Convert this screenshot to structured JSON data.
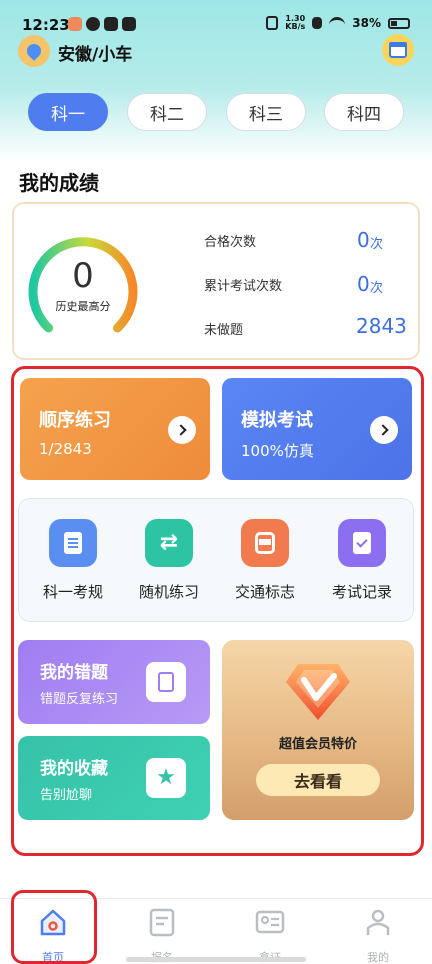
{
  "status_bar": {
    "time": "12:23",
    "net_speed_value": "1.30",
    "net_speed_unit": "KB/s",
    "battery": "38%"
  },
  "header": {
    "location": "安徽/小车",
    "location_icon": "map-pin-icon",
    "calendar_icon": "calendar-check-icon"
  },
  "tabs": [
    {
      "label": "科一",
      "active": true
    },
    {
      "label": "科二",
      "active": false
    },
    {
      "label": "科三",
      "active": false
    },
    {
      "label": "科四",
      "active": false
    }
  ],
  "scores": {
    "title": "我的成绩",
    "highest_score": "0",
    "highest_score_label": "历史最高分",
    "stats": [
      {
        "label": "合格次数",
        "value": "0",
        "unit": "次"
      },
      {
        "label": "累计考试次数",
        "value": "0",
        "unit": "次"
      },
      {
        "label": "未做题",
        "value": "2843",
        "unit": ""
      }
    ],
    "colors": {
      "gauge_start": "#1fc8a0",
      "gauge_end": "#f5892a",
      "value": "#3b6fe0"
    }
  },
  "practice": {
    "sequential": {
      "title": "顺序练习",
      "subtitle": "1/2843",
      "color": "#f19a45"
    },
    "mock_exam": {
      "title": "模拟考试",
      "subtitle": "100%仿真",
      "color": "#527cee"
    }
  },
  "tools": [
    {
      "label": "科一考规",
      "icon": "document-icon",
      "color": "#5a8ef0"
    },
    {
      "label": "随机练习",
      "icon": "shuffle-icon",
      "color": "#2cc4a3"
    },
    {
      "label": "交通标志",
      "icon": "bus-icon",
      "color": "#f27a4f"
    },
    {
      "label": "考试记录",
      "icon": "clipboard-check-icon",
      "color": "#8b6ff0"
    }
  ],
  "mistakes": {
    "title": "我的错题",
    "subtitle": "错题反复练习",
    "icon": "note-icon"
  },
  "favorites": {
    "title": "我的收藏",
    "subtitle": "告别尬聊",
    "icon": "star-icon"
  },
  "vip": {
    "text": "超值会员特价",
    "button": "去看看",
    "icon": "vip-diamond-icon"
  },
  "bottom_nav": [
    {
      "label": "首页",
      "icon": "home-icon",
      "active": true
    },
    {
      "label": "报名",
      "icon": "register-icon",
      "active": false
    },
    {
      "label": "拿证",
      "icon": "license-icon",
      "active": false
    },
    {
      "label": "我的",
      "icon": "profile-icon",
      "active": false
    }
  ]
}
